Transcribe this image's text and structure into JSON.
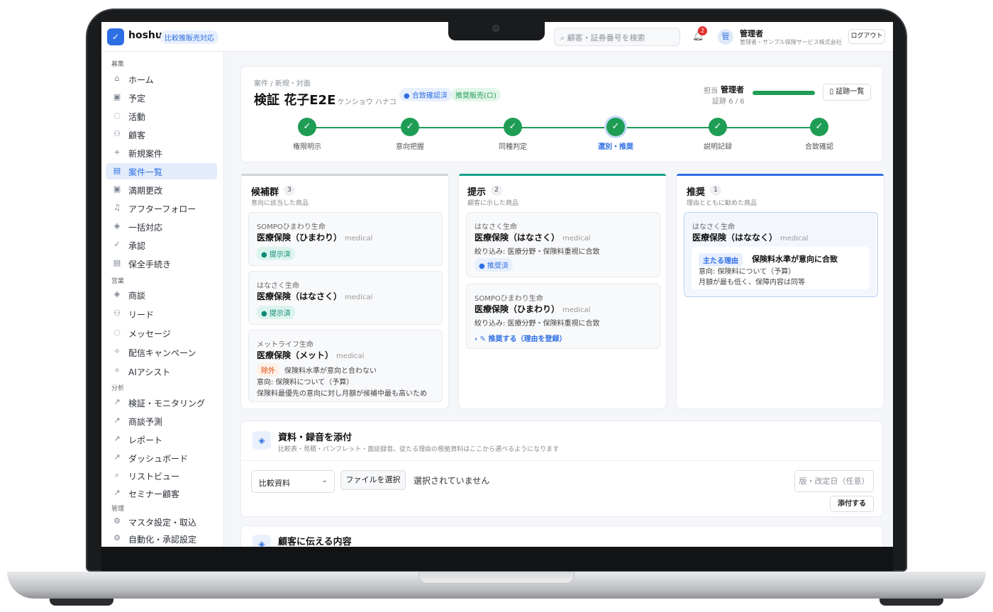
{
  "app": {
    "brand": "hoshu",
    "badge": "比較推販売対応",
    "logo_icon": "shield-check-icon"
  },
  "header": {
    "search_placeholder": "顧客・証券番号を検索",
    "notification_count": "2",
    "avatar_initial": "管",
    "user_name": "管理者",
    "user_org": "管理者・サンプル保険サービス株式会社",
    "logout": "ログアウト"
  },
  "sidebar": {
    "sections": [
      "募集",
      "営業",
      "分析",
      "管理"
    ],
    "items": [
      {
        "label": "ホーム",
        "icon": "home-icon"
      },
      {
        "label": "予定",
        "icon": "calendar-icon"
      },
      {
        "label": "活動",
        "icon": "chat-icon"
      },
      {
        "label": "顧客",
        "icon": "users-icon"
      },
      {
        "label": "新規案件",
        "icon": "plus-icon"
      },
      {
        "label": "案件一覧",
        "icon": "document-icon"
      },
      {
        "label": "満期更改",
        "icon": "calendar-icon"
      },
      {
        "label": "アフターフォロー",
        "icon": "bell-icon"
      },
      {
        "label": "一括対応",
        "icon": "layers-icon"
      },
      {
        "label": "承認",
        "icon": "check-icon"
      },
      {
        "label": "保全手続き",
        "icon": "document-icon"
      },
      {
        "label": "商談",
        "icon": "layers-icon"
      },
      {
        "label": "リード",
        "icon": "users-icon"
      },
      {
        "label": "メッセージ",
        "icon": "chat-icon"
      },
      {
        "label": "配信キャンペーン",
        "icon": "sparkle-icon"
      },
      {
        "label": "AIアシスト",
        "icon": "sparkle-icon"
      },
      {
        "label": "検証・モニタリング",
        "icon": "chart-icon"
      },
      {
        "label": "商談予測",
        "icon": "chart-icon"
      },
      {
        "label": "レポート",
        "icon": "chart-icon"
      },
      {
        "label": "ダッシュボード",
        "icon": "chart-icon"
      },
      {
        "label": "リストビュー",
        "icon": "search-icon"
      },
      {
        "label": "セミナー顧客",
        "icon": "chart-icon"
      },
      {
        "label": "マスタ設定・取込",
        "icon": "gear-icon"
      },
      {
        "label": "自動化・承認設定",
        "icon": "gear-icon"
      }
    ],
    "active_label": "案件一覧"
  },
  "case": {
    "breadcrumb": "案件 / 新規・対面",
    "title": "検証 花子E2E",
    "kana": "ケンショウ ハナコ",
    "tags": [
      "● 合致確認済",
      "推奨販売(ロ)"
    ],
    "owner_label": "担当",
    "owner_name": "管理者",
    "progress_text": "証跡 6 / 6",
    "progress_fraction": 1.0,
    "evidence_button": "証跡一覧",
    "steps": [
      "権限明示",
      "意向把握",
      "同種判定",
      "選別・推奨",
      "説明記録",
      "合致確認"
    ],
    "current_step": "選別・推奨"
  },
  "columns": {
    "candidates": {
      "title": "候補群",
      "count": "3",
      "subtitle": "意向に該当した商品",
      "cards": [
        {
          "insurer": "SOMPOひまわり生命",
          "product": "医療保険（ひまわり）",
          "category": "medical",
          "status": "● 提示済"
        },
        {
          "insurer": "はなさく生命",
          "product": "医療保険（はなさく）",
          "category": "medical",
          "status": "● 提示済"
        },
        {
          "insurer": "メットライフ生命",
          "product": "医療保険（メット）",
          "category": "medical",
          "excluded_tag": "除外",
          "excluded_reason": "保険料水準が意向と合わない",
          "intent": "意向: 保険料について（予算）",
          "note": "保険料最優先の意向に対し月額が候補中最も高いため"
        }
      ]
    },
    "presented": {
      "title": "提示",
      "count": "2",
      "subtitle": "顧客に示した商品",
      "cards": [
        {
          "insurer": "はなさく生命",
          "product": "医療保険（はなさく）",
          "category": "medical",
          "filter": "絞り込み: 医療分野・保険料重視に合致",
          "status": "● 推奨済"
        },
        {
          "insurer": "SOMPOひまわり生命",
          "product": "医療保険（ひまわり）",
          "category": "medical",
          "filter": "絞り込み: 医療分野・保険料重視に合致",
          "action": "› ✎ 推奨する（理由を登録）"
        }
      ]
    },
    "recommended": {
      "title": "推奨",
      "count": "1",
      "subtitle": "理由とともに勧めた商品",
      "card": {
        "insurer": "はなさく生命",
        "product": "医療保険（はななく）",
        "category": "medical",
        "reason_tag": "主たる理由",
        "reason_title": "保険料水準が意向に合致",
        "intent": "意向: 保険料について（予算）",
        "detail": "月額が最も低く、保障内容は同等"
      }
    }
  },
  "attach": {
    "title": "資料・録音を添付",
    "subtitle": "比較表・見積・パンフレット・面談録音。従たる理由の根拠資料はここから選べるようになります",
    "select_value": "比較資料",
    "file_button": "ファイルを選択",
    "file_status": "選択されていません",
    "date_placeholder": "版・改定日（任意）",
    "submit": "添付する"
  },
  "customer_section": {
    "title": "顧客に伝える内容"
  },
  "colors": {
    "accent": "#2f6fe4",
    "success": "#1f9d55",
    "teal": "#0d8a74"
  }
}
